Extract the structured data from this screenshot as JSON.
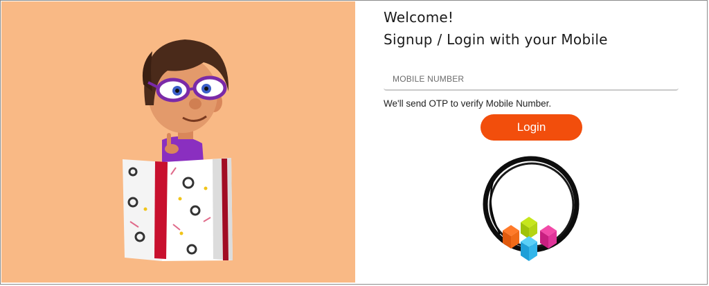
{
  "welcome_title": "Welcome!",
  "subtitle": "Signup / Login with your Mobile",
  "mobile_input": {
    "placeholder": "MOBILE NUMBER",
    "value": ""
  },
  "otp_hint": "We'll send OTP to verify Mobile Number.",
  "login_button": "Login",
  "colors": {
    "hero_background": "#f9b985",
    "login_button": "#f24e0c"
  },
  "icons": {
    "hero": "cartoon-boy-with-gift-box",
    "logo": "brand-ring-logo"
  }
}
